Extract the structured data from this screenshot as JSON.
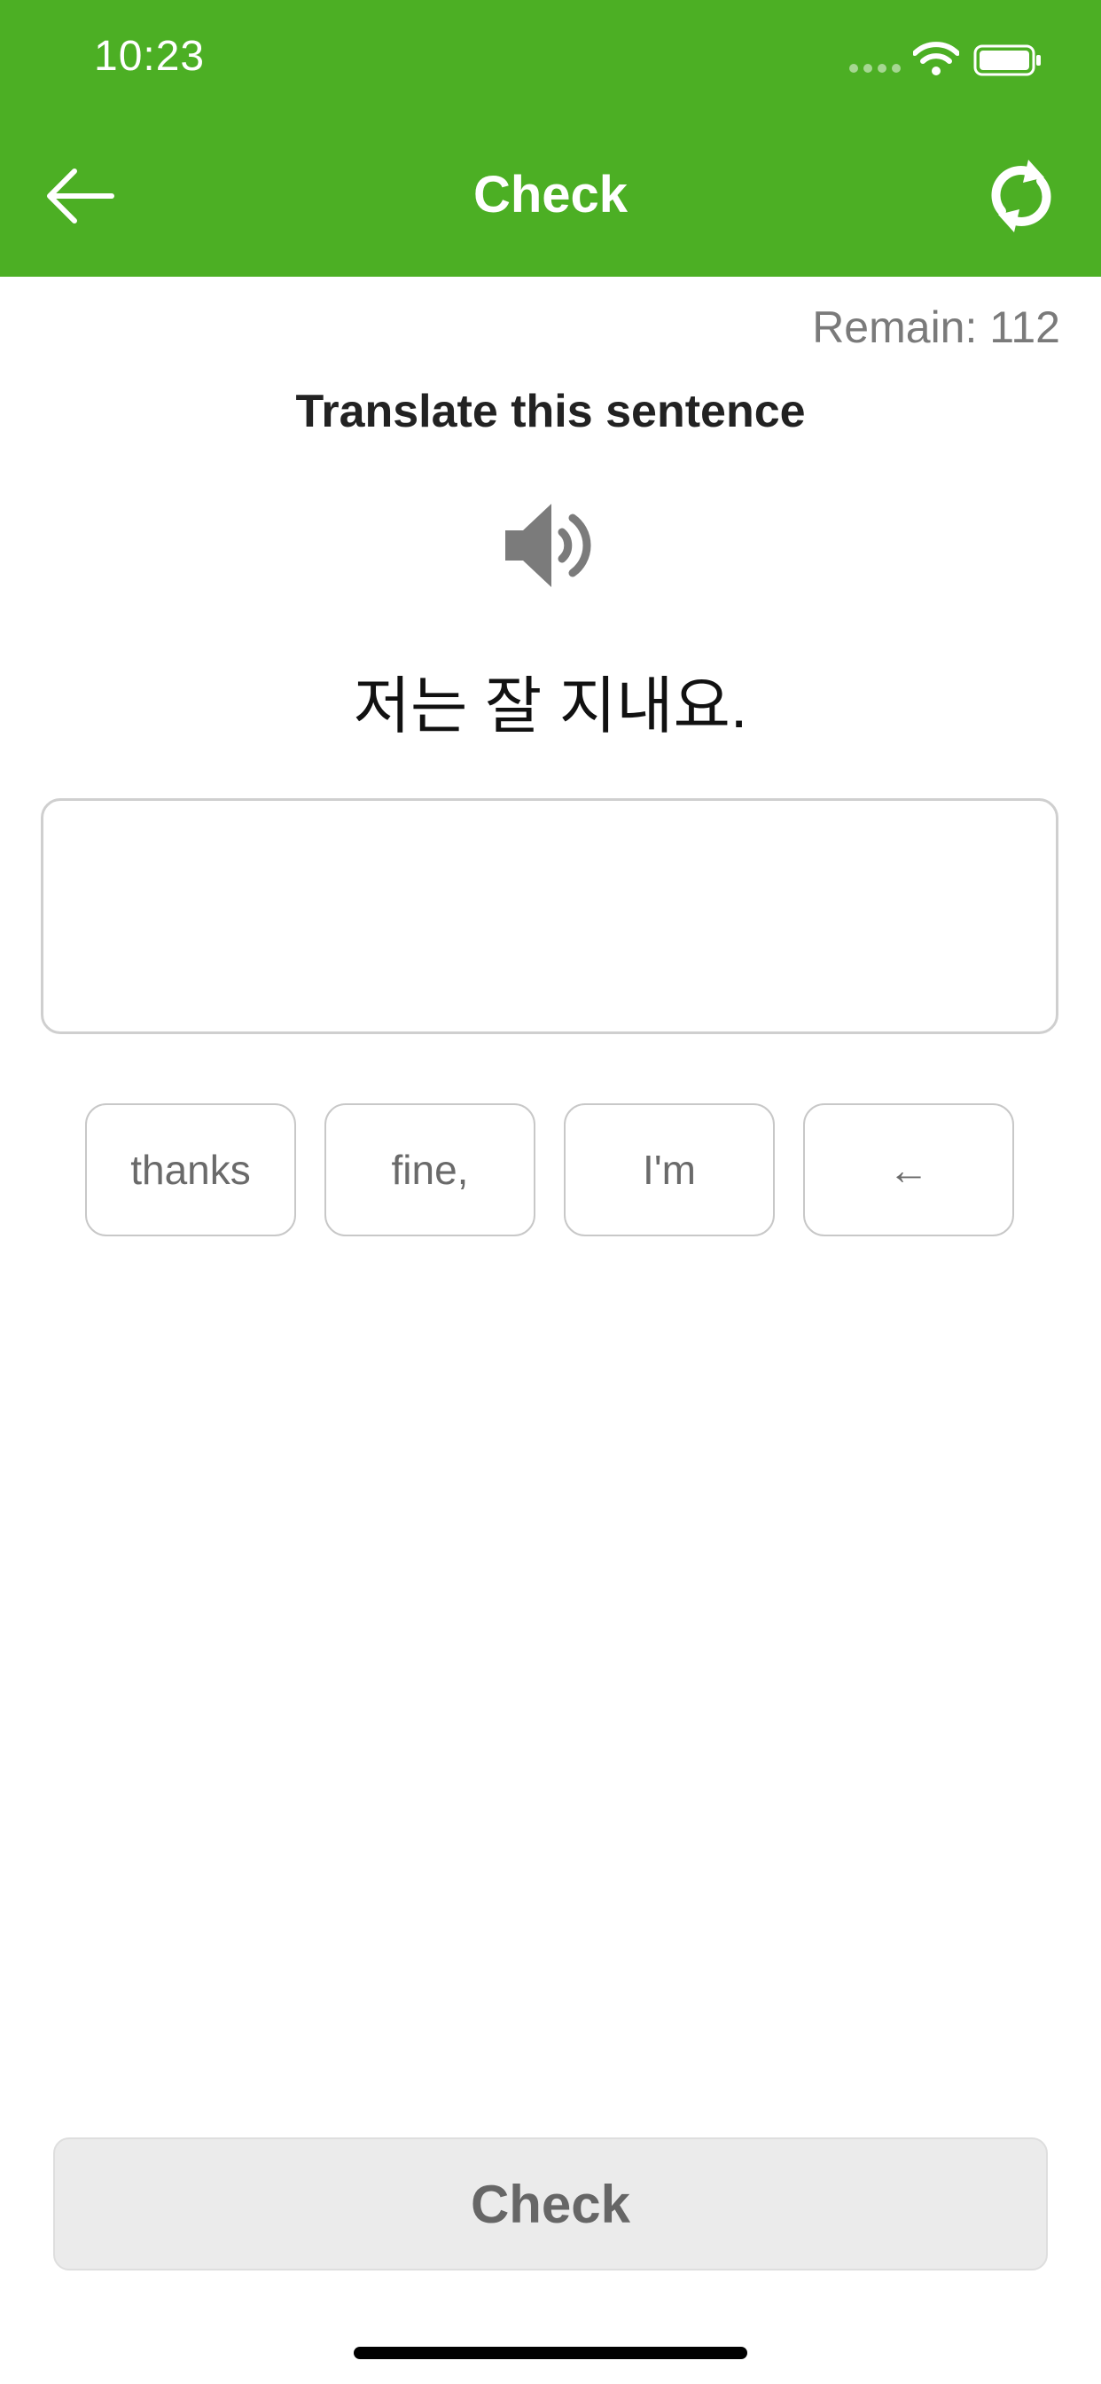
{
  "status_bar": {
    "time": "10:23"
  },
  "header": {
    "title": "Check",
    "back_icon": "arrow-left-icon",
    "refresh_icon": "refresh-icon",
    "color": "#4caf24"
  },
  "exercise": {
    "remain_text": "Remain: 112",
    "prompt": "Translate this sentence",
    "audio_icon": "speaker-icon",
    "sentence": "저는 잘 지내요.",
    "answer_value": ""
  },
  "word_bank": [
    {
      "label": "thanks"
    },
    {
      "label": "fine,"
    },
    {
      "label": "I'm"
    },
    {
      "label": "←"
    }
  ],
  "footer": {
    "check_label": "Check"
  }
}
